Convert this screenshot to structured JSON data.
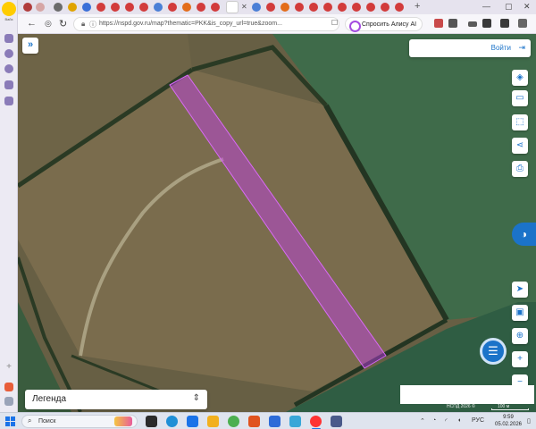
{
  "browser": {
    "url": "https://nspd.gov.ru/map?thematic=PKK&is_copy_url=true&zoom...",
    "alice_button_label": "Спросить Алису AI",
    "profile_label": "Вайз",
    "nav_icons": [
      "back-icon",
      "forward-icon",
      "reload-icon"
    ],
    "accent_color": "#8a5cf0"
  },
  "map": {
    "login_label": "Войти",
    "legend_label": "Легенда",
    "copyright": "НСПД 2026 ©",
    "scale_label": "100 м",
    "highlight_color": "#c53cf0",
    "toolbar_icons": [
      "layers-icon",
      "ruler-icon",
      "select-area-icon",
      "share-icon",
      "print-icon"
    ],
    "nav_tools": [
      "locate-icon",
      "panorama-icon",
      "search-place-icon",
      "zoom-in-icon",
      "zoom-out-icon"
    ],
    "zoom_in_label": "+",
    "zoom_out_label": "−"
  },
  "taskbar": {
    "search_placeholder": "Поиск",
    "language": "РУС",
    "time": "9:59",
    "date": "05.02.2026"
  }
}
